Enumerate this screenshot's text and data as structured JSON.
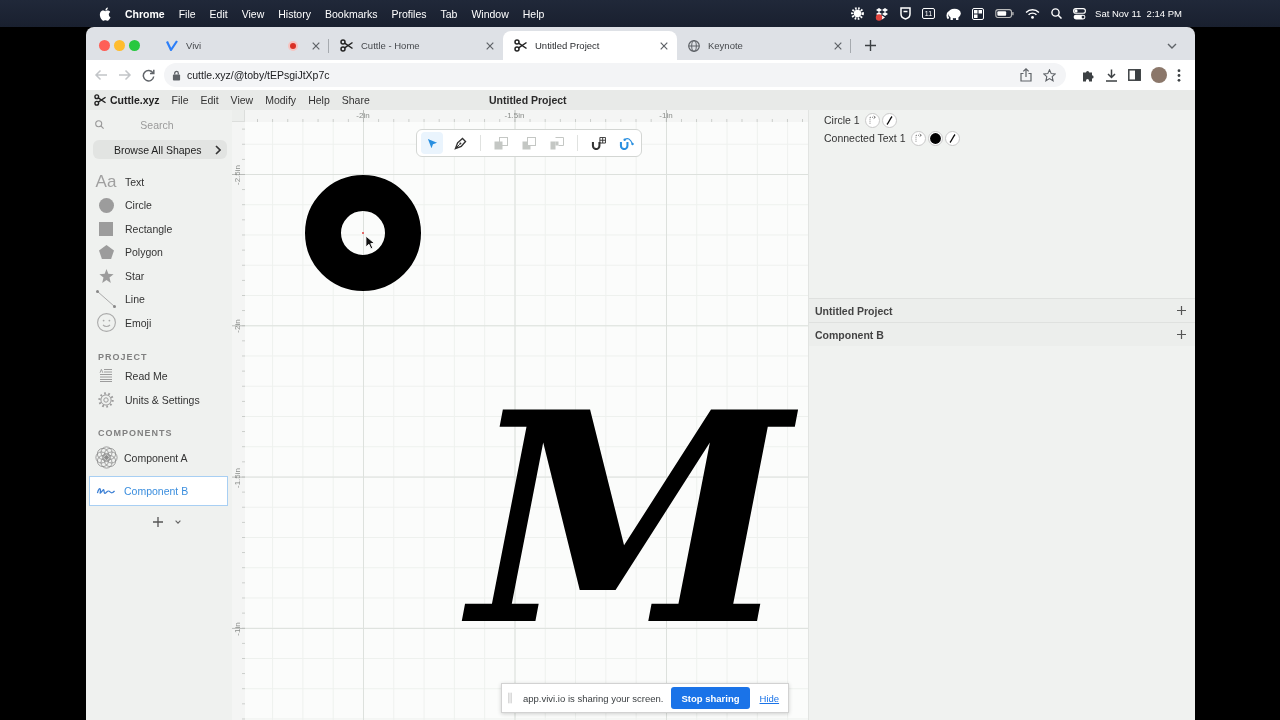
{
  "menu_bar": {
    "app": "Chrome",
    "menus": [
      "File",
      "Edit",
      "View",
      "History",
      "Bookmarks",
      "Profiles",
      "Tab",
      "Window",
      "Help"
    ],
    "calendar_day": "11",
    "clock": "Sat Nov 11  2:14 PM"
  },
  "browser": {
    "tabs": [
      {
        "title": "Vivi",
        "kind": "vivi",
        "selected": false,
        "recording": true
      },
      {
        "title": "Cuttle - Home",
        "kind": "cuttle",
        "selected": false,
        "recording": false
      },
      {
        "title": "Untitled Project",
        "kind": "cuttle",
        "selected": true,
        "recording": false
      },
      {
        "title": "Keynote",
        "kind": "web",
        "selected": false,
        "recording": false
      }
    ],
    "url": "cuttle.xyz/@toby/tEPsgiJtXp7c"
  },
  "app": {
    "name": "Cuttle.xyz",
    "menus": [
      "File",
      "Edit",
      "View",
      "Modify",
      "Help",
      "Share"
    ],
    "title": "Untitled Project"
  },
  "sidebar": {
    "search": {
      "placeholder": "Search"
    },
    "browse_button": "Browse All Shapes",
    "shapes": [
      {
        "kind": "text",
        "glyph": "Aa",
        "label": "Text"
      },
      {
        "kind": "circle",
        "label": "Circle"
      },
      {
        "kind": "rectangle",
        "label": "Rectangle"
      },
      {
        "kind": "polygon",
        "label": "Polygon"
      },
      {
        "kind": "star",
        "label": "Star"
      },
      {
        "kind": "line",
        "label": "Line"
      },
      {
        "kind": "emoji",
        "label": "Emoji"
      }
    ],
    "project": {
      "heading": "PROJECT",
      "items": [
        {
          "kind": "document",
          "label": "Read Me"
        },
        {
          "kind": "settings",
          "label": "Units & Settings"
        }
      ]
    },
    "components": {
      "heading": "COMPONENTS",
      "items": [
        {
          "kind": "rosette",
          "label": "Component A",
          "selected": false
        },
        {
          "kind": "script",
          "label": "Component B",
          "selected": true
        }
      ]
    }
  },
  "canvas": {
    "x_ruler": [
      "-2in",
      "-1.5in",
      "-1in"
    ],
    "y_ruler": [
      "-2.5in",
      "-2in",
      "-1.5in",
      "-1in"
    ],
    "tools": [
      {
        "kind": "select",
        "selected": true
      },
      {
        "kind": "pen",
        "selected": false
      }
    ],
    "operations": [
      {
        "kind": "union",
        "disabled": true
      },
      {
        "kind": "subtract",
        "disabled": true
      },
      {
        "kind": "intersect",
        "disabled": true
      }
    ],
    "snapping": [
      {
        "kind": "grid",
        "on": false
      },
      {
        "kind": "curve",
        "on": true
      }
    ],
    "shapes": [
      {
        "kind": "ring"
      },
      {
        "kind": "text",
        "text": "M"
      }
    ]
  },
  "layers": [
    {
      "name": "Circle 1",
      "badges": [
        {
          "kind": "transform"
        },
        {
          "kind": "stroke"
        }
      ]
    },
    {
      "name": "Connected Text 1",
      "badges": [
        {
          "kind": "transform"
        },
        {
          "kind": "fill"
        },
        {
          "kind": "stroke"
        }
      ]
    }
  ],
  "sections": [
    {
      "title": "Untitled Project"
    },
    {
      "title": "Component B"
    }
  ],
  "share_bar": {
    "message": "app.vivi.io is sharing your screen.",
    "stop_button": "Stop sharing",
    "hide_link": "Hide"
  }
}
